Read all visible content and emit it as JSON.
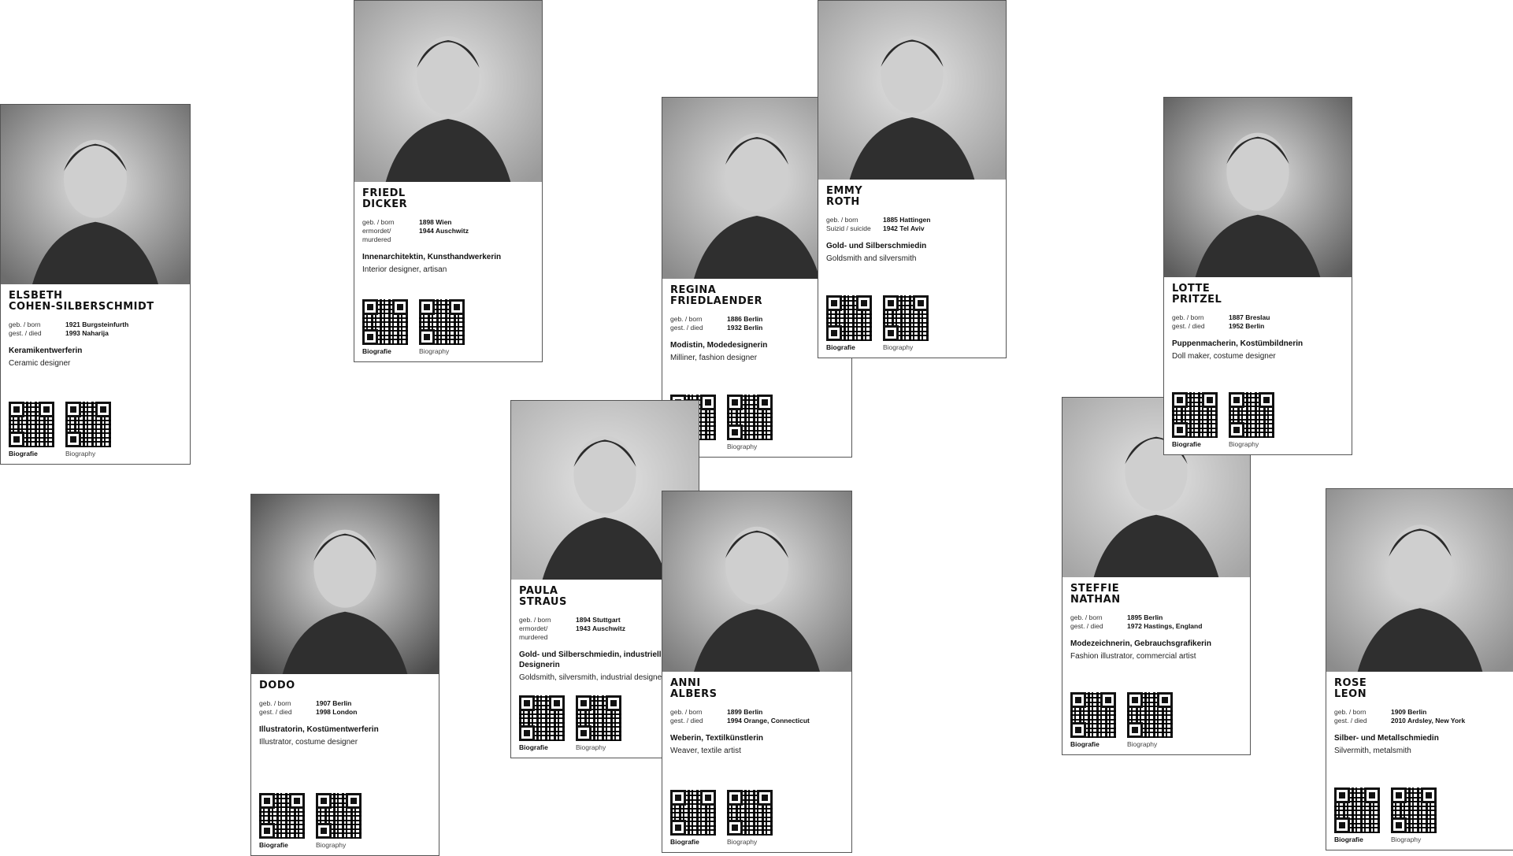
{
  "cards": [
    {
      "id": "cohen",
      "name_line1": "ELSBETH",
      "name_line2": "COHEN-SILBERSCHMIDT",
      "born_label": "geb. / born",
      "born_value": "1921 Burgsteinfurth",
      "died_label": "gest. / died",
      "died_value": "1993 Naharija",
      "prof_de": "Keramikentwerferin",
      "prof_en": "Ceramic designer",
      "qr_de": "Biografie",
      "qr_en": "Biography"
    },
    {
      "id": "dicker",
      "name_line1": "FRIEDL",
      "name_line2": "DICKER",
      "born_label": "geb. / born",
      "born_value": "1898 Wien",
      "died_label": "ermordet/ murdered",
      "died_value": "1944 Auschwitz",
      "prof_de": "Innenarchitektin, Kunsthandwerkerin",
      "prof_en": "Interior designer, artisan",
      "qr_de": "Biografie",
      "qr_en": "Biography"
    },
    {
      "id": "friedlaender",
      "name_line1": "REGINA",
      "name_line2": "FRIEDLAENDER",
      "born_label": "geb. / born",
      "born_value": "1886 Berlin",
      "died_label": "gest. / died",
      "died_value": "1932 Berlin",
      "prof_de": "Modistin, Modedesignerin",
      "prof_en": "Milliner, fashion designer",
      "qr_de": "Biografie",
      "qr_en": "Biography"
    },
    {
      "id": "roth",
      "name_line1": "EMMY",
      "name_line2": "ROTH",
      "born_label": "geb. / born",
      "born_value": "1885 Hattingen",
      "died_label": "Suizid / suicide",
      "died_value": "1942 Tel Aviv",
      "prof_de": "Gold- und Silberschmiedin",
      "prof_en": "Goldsmith and silversmith",
      "qr_de": "Biografie",
      "qr_en": "Biography"
    },
    {
      "id": "pritzel",
      "name_line1": "LOTTE",
      "name_line2": "PRITZEL",
      "born_label": "geb. / born",
      "born_value": "1887 Breslau",
      "died_label": "gest. / died",
      "died_value": "1952 Berlin",
      "prof_de": "Puppenmacherin, Kostümbildnerin",
      "prof_en": "Doll maker, costume designer",
      "qr_de": "Biografie",
      "qr_en": "Biography"
    },
    {
      "id": "dodo",
      "name_line1": "DODO",
      "name_line2": "",
      "born_label": "geb. / born",
      "born_value": "1907 Berlin",
      "died_label": "gest. / died",
      "died_value": "1998 London",
      "prof_de": "Illustratorin, Kostümentwerferin",
      "prof_en": "Illustrator, costume designer",
      "qr_de": "Biografie",
      "qr_en": "Biography"
    },
    {
      "id": "straus",
      "name_line1": "PAULA",
      "name_line2": "STRAUS",
      "born_label": "geb. / born",
      "born_value": "1894 Stuttgart",
      "died_label": "ermordet/ murdered",
      "died_value": "1943 Auschwitz",
      "prof_de": "Gold- und Silberschmiedin, industrielle Designerin",
      "prof_en": "Goldsmith, silversmith, industrial designer",
      "qr_de": "Biografie",
      "qr_en": "Biography"
    },
    {
      "id": "albers",
      "name_line1": "ANNI",
      "name_line2": "ALBERS",
      "born_label": "geb. / born",
      "born_value": "1899 Berlin",
      "died_label": "gest. / died",
      "died_value": "1994 Orange, Connecticut",
      "prof_de": "Weberin, Textilkünstlerin",
      "prof_en": "Weaver, textile artist",
      "qr_de": "Biografie",
      "qr_en": "Biography"
    },
    {
      "id": "nathan",
      "name_line1": "STEFFIE",
      "name_line2": "NATHAN",
      "born_label": "geb. / born",
      "born_value": "1895 Berlin",
      "died_label": "gest. / died",
      "died_value": "1972 Hastings, England",
      "prof_de": "Modezeichnerin, Gebrauchsgrafikerin",
      "prof_en": "Fashion illustrator, commercial artist",
      "qr_de": "Biografie",
      "qr_en": "Biography"
    },
    {
      "id": "leon",
      "name_line1": "ROSE",
      "name_line2": "LEON",
      "born_label": "geb. / born",
      "born_value": "1909 Berlin",
      "died_label": "gest. / died",
      "died_value": "2010 Ardsley, New York",
      "prof_de": "Silber- und Metallschmiedin",
      "prof_en": "Silvermith, metalsmith",
      "qr_de": "Biografie",
      "qr_en": "Biography"
    }
  ]
}
